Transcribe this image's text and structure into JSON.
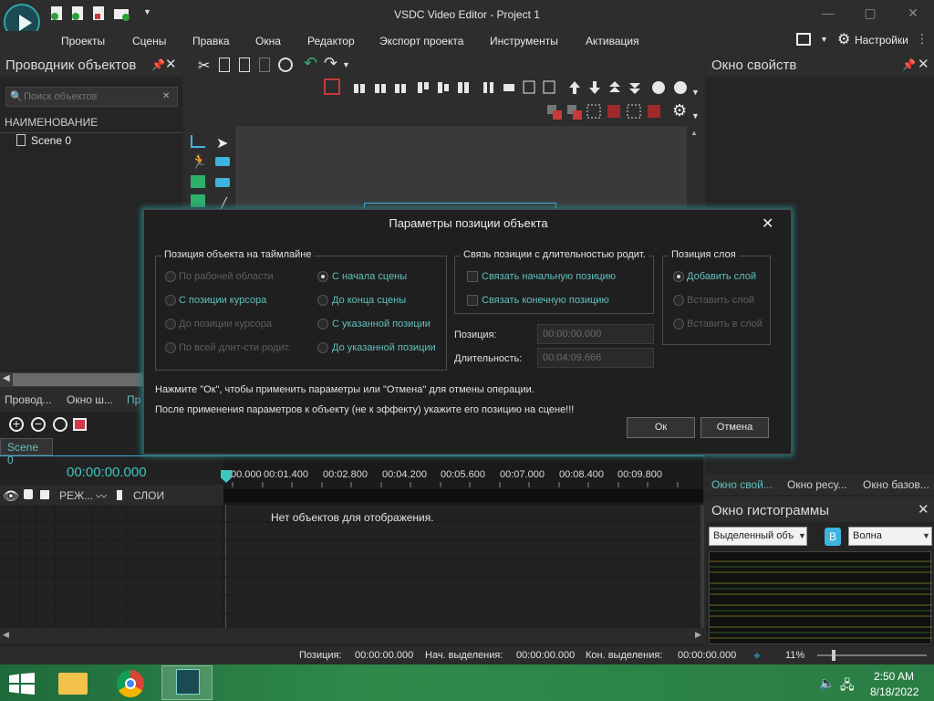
{
  "window": {
    "title": "VSDC Video Editor - Project 1",
    "min": "—",
    "max": "▢",
    "close": "✕"
  },
  "menu": [
    "Проекты",
    "Сцены",
    "Правка",
    "Окна",
    "Редактор",
    "Экспорт проекта",
    "Инструменты",
    "Активация"
  ],
  "settings_label": "Настройки",
  "explorer": {
    "title": "Проводник объектов",
    "search_placeholder": "Поиск объектов",
    "column_header": "НАИМЕНОВАНИЕ",
    "tree": [
      "Scene 0"
    ],
    "tabs": [
      "Провод...",
      "Окно ш...",
      "Пр"
    ]
  },
  "properties": {
    "title": "Окно свойств",
    "tabs": [
      "Окно свой...",
      "Окно ресу...",
      "Окно базов..."
    ]
  },
  "histogram": {
    "title": "Окно гистограммы",
    "source_select": "Выделенный объ",
    "mode_select": "Волна",
    "channel_badge": "B"
  },
  "timeline": {
    "scene_tab": "Scene 0",
    "current_time": "00:00:00.000",
    "ruler": [
      "00.000",
      "00:01.400",
      "00:02.800",
      "00:04.200",
      "00:05.600",
      "00:07.000",
      "00:08.400",
      "00:09.800"
    ],
    "col_mode": "РЕЖ...",
    "col_layers": "СЛОИ",
    "empty_message": "Нет объектов для отображения."
  },
  "dialog": {
    "title": "Параметры позиции объекта",
    "group_timeline": {
      "legend": "Позиция объекта на таймлайне",
      "left": [
        {
          "label": "По рабочей области",
          "enabled": false,
          "checked": false
        },
        {
          "label": "С позиции курсора",
          "enabled": true,
          "checked": false
        },
        {
          "label": "До позиции курсора",
          "enabled": false,
          "checked": false
        },
        {
          "label": "По всей длит-сти родит.",
          "enabled": false,
          "checked": false
        }
      ],
      "right": [
        {
          "label": "С начала сцены",
          "enabled": true,
          "checked": true
        },
        {
          "label": "До конца сцены",
          "enabled": true,
          "checked": false
        },
        {
          "label": "С указанной позиции",
          "enabled": true,
          "checked": false
        },
        {
          "label": "До указанной позиции",
          "enabled": true,
          "checked": false
        }
      ]
    },
    "group_link": {
      "legend": "Связь позиции с длительностью родит.",
      "options": [
        "Связать начальную позицию",
        "Связать конечную позицию"
      ]
    },
    "group_layer": {
      "legend": "Позиция слоя",
      "options": [
        {
          "label": "Добавить слой",
          "enabled": true,
          "checked": true
        },
        {
          "label": "Вставить слой",
          "enabled": false,
          "checked": false
        },
        {
          "label": "Вставить в слой",
          "enabled": false,
          "checked": false
        }
      ]
    },
    "position_label": "Позиция:",
    "position_value": "00:00:00.000",
    "duration_label": "Длительность:",
    "duration_value": "00:04:09.666",
    "hint1": "Нажмите \"Ок\", чтобы применить параметры или \"Отмена\" для отмены операции.",
    "hint2": "После применения параметров к объекту (не к эффекту) укажите его позицию на сцене!!!",
    "ok": "Ок",
    "cancel": "Отмена"
  },
  "status": {
    "position_label": "Позиция:",
    "position_value": "00:00:00.000",
    "sel_start_label": "Нач. выделения:",
    "sel_start_value": "00:00:00.000",
    "sel_end_label": "Кон. выделения:",
    "sel_end_value": "00:00:00.000",
    "zoom": "11%"
  },
  "taskbar": {
    "time": "2:50 AM",
    "date": "8/18/2022"
  },
  "colors": {
    "accent": "#5fc2bd",
    "timecode": "#3ec6c0",
    "playhead": "#c0262d",
    "taskbar": "#2f8a4a"
  }
}
